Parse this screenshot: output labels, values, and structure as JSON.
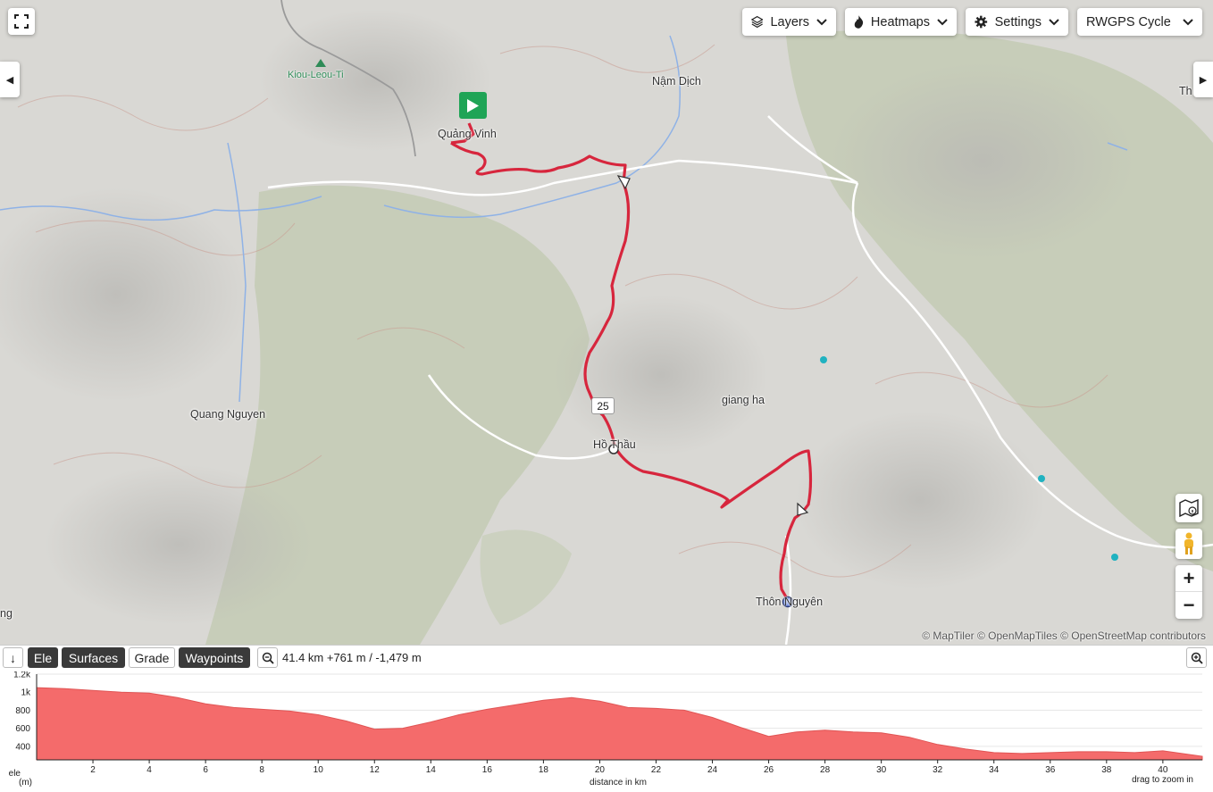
{
  "map": {
    "dropdowns": [
      {
        "id": "layers",
        "label": "Layers",
        "icon": "layers-icon"
      },
      {
        "id": "heatmaps",
        "label": "Heatmaps",
        "icon": "flame-icon"
      },
      {
        "id": "settings",
        "label": "Settings",
        "icon": "gear-icon"
      },
      {
        "id": "basemap",
        "label": "RWGPS Cycle",
        "icon": ""
      }
    ],
    "places": {
      "quang_vinh": "Quảng Vinh",
      "nam_dich": "Nậm Dịch",
      "quang_nguyen": "Quang Nguyen",
      "giang_ha": "giang ha",
      "ho_thau": "Hồ Thầu",
      "thon_nguyen": "Thôn Nguyên",
      "left_edge": "ng",
      "right_edge": "Th"
    },
    "peak": "Kiou-Leou-Ti",
    "marker_label": "25",
    "attribution": "© MapTiler © OpenMapTiles © OpenStreetMap contributors"
  },
  "elevation_panel": {
    "tabs": [
      {
        "label": "Ele",
        "active": true
      },
      {
        "label": "Surfaces",
        "active": true
      },
      {
        "label": "Grade",
        "active": false
      },
      {
        "label": "Waypoints",
        "active": true
      }
    ],
    "stats": "41.4 km +761 m / -1,479 m",
    "xlabel": "distance in km",
    "ylabel_line1": "ele",
    "ylabel_line2": "(m)",
    "hint": "drag to zoom in"
  },
  "chart_data": {
    "type": "area",
    "xlabel": "distance in km",
    "ylabel": "ele (m)",
    "xlim": [
      0,
      41.4
    ],
    "ylim": [
      250,
      1200
    ],
    "yticks": [
      400,
      600,
      800,
      1000,
      1200
    ],
    "ytick_labels": [
      "400",
      "600",
      "800",
      "1k",
      "1.2k"
    ],
    "xticks": [
      2,
      4,
      6,
      8,
      10,
      12,
      14,
      16,
      18,
      20,
      22,
      24,
      26,
      28,
      30,
      32,
      34,
      36,
      38,
      40
    ],
    "color": "#f46b6b",
    "x": [
      0,
      1,
      2,
      3,
      4,
      5,
      6,
      7,
      8,
      9,
      10,
      11,
      12,
      13,
      14,
      15,
      16,
      17,
      18,
      19,
      20,
      21,
      22,
      23,
      24,
      25,
      26,
      27,
      28,
      29,
      30,
      31,
      32,
      33,
      34,
      35,
      36,
      37,
      38,
      39,
      40,
      41.4
    ],
    "y": [
      1050,
      1040,
      1020,
      1000,
      990,
      940,
      870,
      830,
      810,
      790,
      750,
      680,
      590,
      600,
      670,
      750,
      810,
      860,
      910,
      940,
      900,
      830,
      820,
      800,
      720,
      610,
      510,
      560,
      580,
      560,
      550,
      500,
      420,
      370,
      330,
      320,
      330,
      340,
      340,
      330,
      350,
      290
    ]
  }
}
